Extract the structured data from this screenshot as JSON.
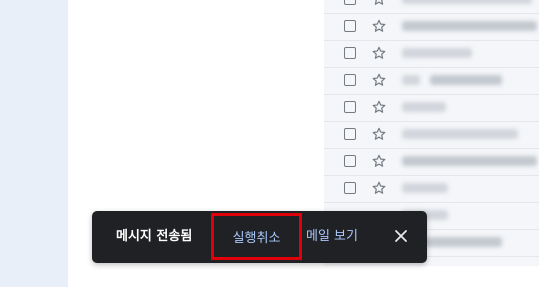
{
  "snackbar": {
    "message": "메시지 전송됨",
    "undo_label": "실행취소",
    "view_label": "메일 보기",
    "close_icon": "close-icon"
  },
  "mail_list": {
    "row_icons": {
      "checkbox": "checkbox-icon",
      "star": "star-outline-icon"
    },
    "row_count": 10
  },
  "colors": {
    "snackbar_bg": "#202124",
    "action_text": "#a8c7fa",
    "highlight_border": "#e0000a",
    "app_bg": "#e9eff8"
  }
}
